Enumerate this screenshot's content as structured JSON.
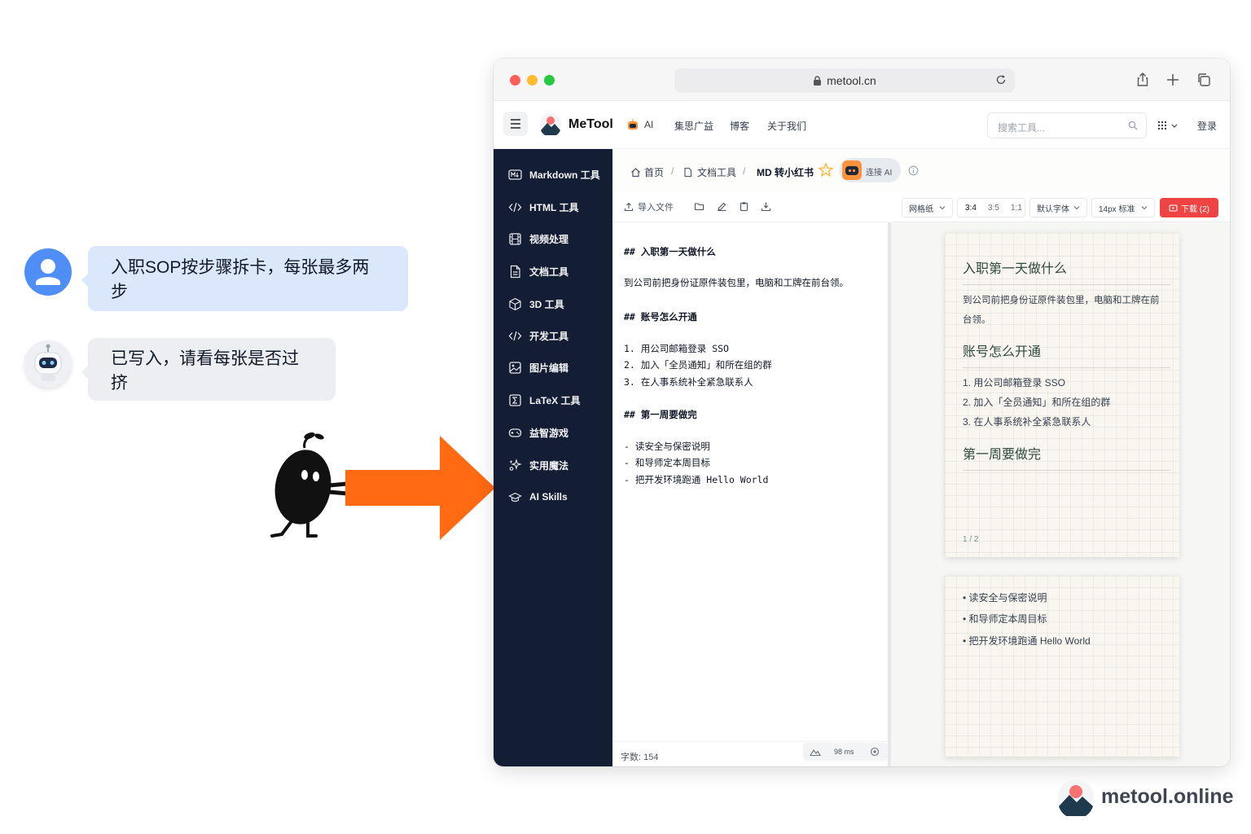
{
  "chat": {
    "user_message": "入职SOP按步骤拆卡，每张最多两步",
    "bot_message": "已写入，请看每张是否过挤"
  },
  "browser": {
    "url": "metool.cn"
  },
  "header": {
    "brand": "MeTool",
    "nav": [
      "AI",
      "集思广益",
      "博客",
      "关于我们"
    ],
    "search_placeholder": "搜索工具...",
    "login": "登录"
  },
  "sidebar": {
    "items": [
      {
        "label": "Markdown 工具",
        "icon": "markdown-icon"
      },
      {
        "label": "HTML 工具",
        "icon": "code-icon"
      },
      {
        "label": "视频处理",
        "icon": "film-icon"
      },
      {
        "label": "文档工具",
        "icon": "document-icon"
      },
      {
        "label": "3D 工具",
        "icon": "cube-icon"
      },
      {
        "label": "开发工具",
        "icon": "code-icon"
      },
      {
        "label": "图片编辑",
        "icon": "image-icon"
      },
      {
        "label": "LaTeX 工具",
        "icon": "sigma-icon"
      },
      {
        "label": "益智游戏",
        "icon": "gamepad-icon"
      },
      {
        "label": "实用魔法",
        "icon": "sparkles-icon"
      },
      {
        "label": "AI Skills",
        "icon": "graduation-cap-icon"
      }
    ]
  },
  "breadcrumb": {
    "home": "首页",
    "category": "文档工具",
    "current": "MD 转小红书",
    "separator": "/",
    "ai_connect": "连接 AI"
  },
  "editor_toolbar": {
    "import": "导入文件"
  },
  "preview_toolbar": {
    "paper": "网格纸",
    "ratios": [
      "3:4",
      "3:5",
      "1:1"
    ],
    "font": "默认字体",
    "size": "14px 标准",
    "download": "下载 (2)"
  },
  "editor": {
    "lines": [
      "## 入职第一天做什么",
      "到公司前把身份证原件装包里，电脑和工牌在前台领。",
      "## 账号怎么开通",
      "1. 用公司邮箱登录 SSO",
      "2. 加入「全员通知」和所在组的群",
      "3. 在人事系统补全紧急联系人",
      "## 第一周要做完",
      "- 读安全与保密说明",
      "- 和导师定本周目标",
      "- 把开发环境跑通 Hello World"
    ],
    "word_count": "字数: 154",
    "latency": "98 ms"
  },
  "preview": {
    "card1": {
      "h1": "入职第一天做什么",
      "p1_line1": "到公司前把身份证原件装包里，电脑和工牌在前",
      "p1_line2": "台领。",
      "h2": "账号怎么开通",
      "list": [
        "1. 用公司邮箱登录 SSO",
        "2. 加入「全员通知」和所在组的群",
        "3. 在人事系统补全紧急联系人"
      ],
      "h3": "第一周要做完",
      "page": "1 / 2"
    },
    "card2": {
      "bullets": [
        "读安全与保密说明",
        "和导师定本周目标",
        "把开发环境跑通 Hello World"
      ]
    }
  },
  "watermark": "metool.online",
  "colors": {
    "sidebar_bg": "#131d33",
    "accent_orange": "#ff6a13",
    "download_red": "#ef4444",
    "user_bubble": "#dbe8fb",
    "preview_heading": "#2f4a3b"
  }
}
